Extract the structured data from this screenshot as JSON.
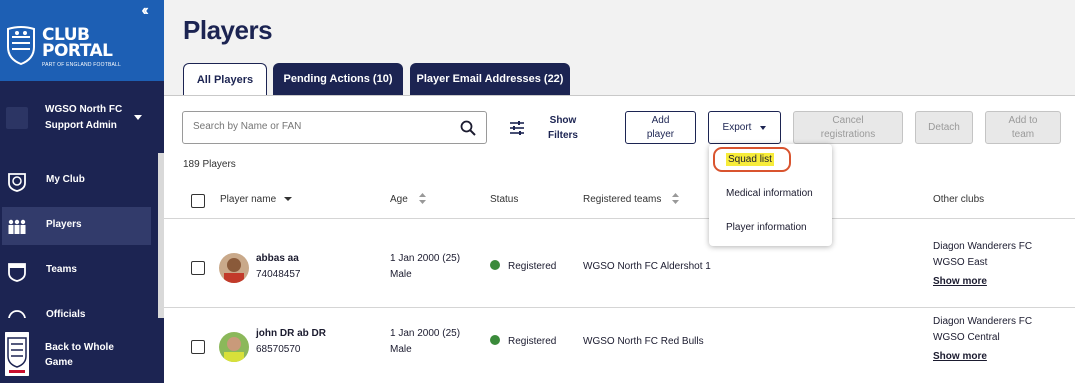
{
  "sidebar": {
    "collapse_icon": "double-chevron-left",
    "logo": {
      "line1": "CLUB",
      "line2": "PORTAL",
      "subtitle": "PART OF ENGLAND FOOTBALL"
    },
    "org": {
      "name": "WGSO North FC",
      "role": "Support Admin"
    },
    "nav": [
      {
        "label": "My Club",
        "icon": "club-crest-icon",
        "active": false
      },
      {
        "label": "Players",
        "icon": "players-group-icon",
        "active": true
      },
      {
        "label": "Teams",
        "icon": "team-shield-icon",
        "active": false
      },
      {
        "label": "Officials",
        "icon": "officials-icon",
        "active": false
      }
    ],
    "back": {
      "label": "Back to Whole Game",
      "icon": "england-crest-icon"
    }
  },
  "page": {
    "title": "Players"
  },
  "tabs": [
    {
      "label": "All Players",
      "active": true
    },
    {
      "label": "Pending Actions (10)",
      "active": false
    },
    {
      "label": "Player Email Addresses (22)",
      "active": false
    }
  ],
  "toolbar": {
    "search_placeholder": "Search by Name or FAN",
    "show_filters": "Show Filters",
    "add_player": "Add player",
    "export": "Export",
    "cancel_registrations": "Cancel registrations",
    "detach": "Detach",
    "add_to_team": "Add to team"
  },
  "export_menu": {
    "items": [
      "Squad list",
      "Medical information",
      "Player information"
    ],
    "highlighted": "Squad list"
  },
  "table": {
    "count": "189 Players",
    "columns": [
      "Player name",
      "Age",
      "Status",
      "Registered teams",
      "Other clubs"
    ],
    "rows": [
      {
        "name": "abbas aa",
        "fan": "74048457",
        "dob": "1 Jan 2000 (25)",
        "gender": "Male",
        "status": "Registered",
        "team": "WGSO North FC Aldershot 1",
        "other_clubs": [
          "Diagon Wanderers FC",
          "WGSO East"
        ],
        "show_more": "Show more"
      },
      {
        "name": "john DR ab DR",
        "fan": "68570570",
        "dob": "1 Jan 2000 (25)",
        "gender": "Male",
        "status": "Registered",
        "team": "WGSO North FC Red Bulls",
        "other_clubs": [
          "Diagon Wanderers FC",
          "WGSO Central"
        ],
        "show_more": "Show more"
      }
    ]
  },
  "colors": {
    "navy": "#1c2452",
    "brand_blue": "#1d5fb4",
    "status_green": "#3a8a3a",
    "highlight_yellow": "#f7ec3a",
    "annotation_red": "#d9542f"
  }
}
